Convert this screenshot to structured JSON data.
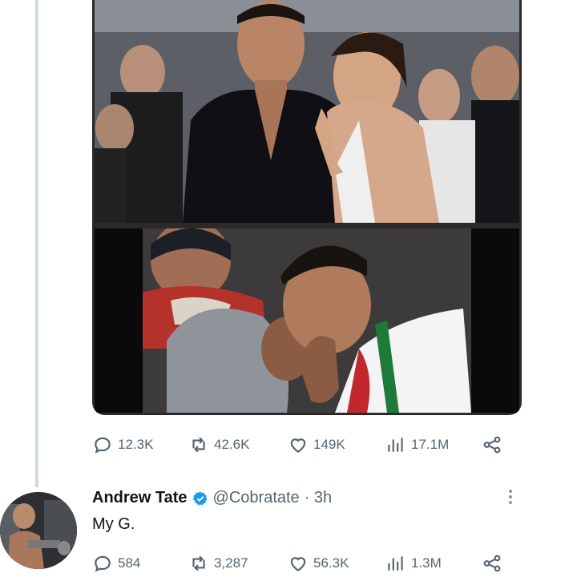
{
  "main_tweet": {
    "stats": {
      "replies": "12.3K",
      "retweets": "42.6K",
      "likes": "149K",
      "views": "17.1M"
    }
  },
  "reply": {
    "name": "Andrew Tate",
    "handle": "@Cobratate",
    "time": "· 3h",
    "text": "My G.",
    "stats": {
      "replies": "584",
      "retweets": "3,287",
      "likes": "56.3K",
      "views": "1.3M"
    }
  },
  "colors": {
    "verified": "#1d9bf0",
    "muted": "#536471",
    "thread_line": "#cfd9de"
  },
  "icons": [
    "reply-icon",
    "retweet-icon",
    "like-icon",
    "views-icon",
    "share-icon",
    "verified-icon",
    "more-icon"
  ]
}
